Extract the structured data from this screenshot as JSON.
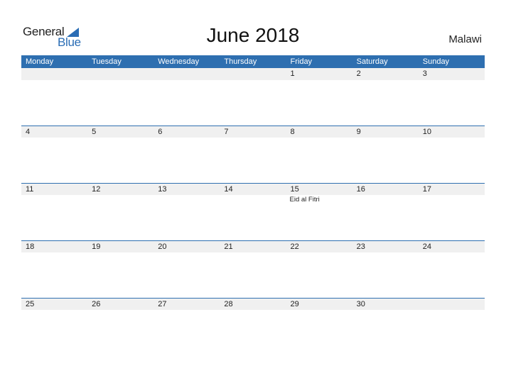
{
  "logo": {
    "word1": "General",
    "word2": "Blue"
  },
  "title": "June 2018",
  "country": "Malawi",
  "colors": {
    "accent": "#2e6fb0",
    "band": "#f0f0f0"
  },
  "weekdays": [
    "Monday",
    "Tuesday",
    "Wednesday",
    "Thursday",
    "Friday",
    "Saturday",
    "Sunday"
  ],
  "weeks": [
    {
      "days": [
        "",
        "",
        "",
        "",
        "1",
        "2",
        "3"
      ],
      "events": [
        "",
        "",
        "",
        "",
        "",
        "",
        ""
      ]
    },
    {
      "days": [
        "4",
        "5",
        "6",
        "7",
        "8",
        "9",
        "10"
      ],
      "events": [
        "",
        "",
        "",
        "",
        "",
        "",
        ""
      ]
    },
    {
      "days": [
        "11",
        "12",
        "13",
        "14",
        "15",
        "16",
        "17"
      ],
      "events": [
        "",
        "",
        "",
        "",
        "Eid al Fitri",
        "",
        ""
      ]
    },
    {
      "days": [
        "18",
        "19",
        "20",
        "21",
        "22",
        "23",
        "24"
      ],
      "events": [
        "",
        "",
        "",
        "",
        "",
        "",
        ""
      ]
    },
    {
      "days": [
        "25",
        "26",
        "27",
        "28",
        "29",
        "30",
        ""
      ],
      "events": [
        "",
        "",
        "",
        "",
        "",
        "",
        ""
      ]
    }
  ]
}
